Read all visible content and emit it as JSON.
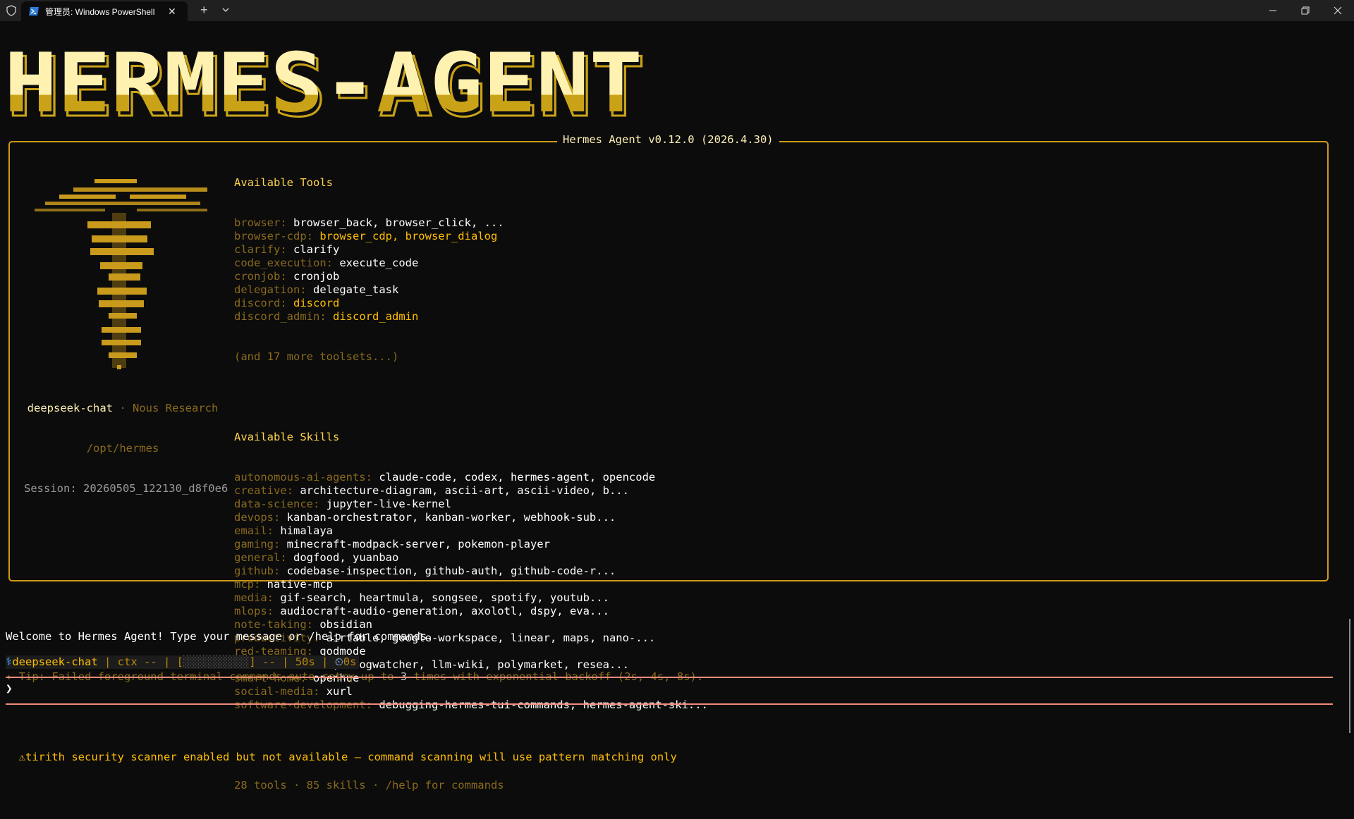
{
  "window": {
    "tab_title": "管理员: Windows PowerShell",
    "tab_icon": "powershell-icon",
    "new_tab_glyph": "+",
    "close_glyph": "✕"
  },
  "banner": {
    "logo_text": "HERMES-AGENT",
    "version_title": "Hermes Agent v0.12.0 (2026.4.30)"
  },
  "sidebar": {
    "model": "deepseek-chat",
    "separator": " · ",
    "org": "Nous Research",
    "path": "/opt/hermes",
    "session": "Session: 20260505_122130_d8f0e6"
  },
  "tools": {
    "heading": "Available Tools",
    "rows": [
      {
        "cat": "browser:",
        "items": "browser_back, browser_click, ...",
        "highlight": false
      },
      {
        "cat": "browser-cdp:",
        "items": "browser_cdp, browser_dialog",
        "highlight": true
      },
      {
        "cat": "clarify:",
        "items": "clarify",
        "highlight": false
      },
      {
        "cat": "code_execution:",
        "items": "execute_code",
        "highlight": false
      },
      {
        "cat": "cronjob:",
        "items": "cronjob",
        "highlight": false
      },
      {
        "cat": "delegation:",
        "items": "delegate_task",
        "highlight": false
      },
      {
        "cat": "discord:",
        "items": "discord",
        "highlight": true
      },
      {
        "cat": "discord_admin:",
        "items": "discord_admin",
        "highlight": true
      }
    ],
    "more": "(and 17 more toolsets...)"
  },
  "skills": {
    "heading": "Available Skills",
    "rows": [
      {
        "cat": "autonomous-ai-agents:",
        "items": "claude-code, codex, hermes-agent, opencode"
      },
      {
        "cat": "creative:",
        "items": "architecture-diagram, ascii-art, ascii-video, b..."
      },
      {
        "cat": "data-science:",
        "items": "jupyter-live-kernel"
      },
      {
        "cat": "devops:",
        "items": "kanban-orchestrator, kanban-worker, webhook-sub..."
      },
      {
        "cat": "email:",
        "items": "himalaya"
      },
      {
        "cat": "gaming:",
        "items": "minecraft-modpack-server, pokemon-player"
      },
      {
        "cat": "general:",
        "items": "dogfood, yuanbao"
      },
      {
        "cat": "github:",
        "items": "codebase-inspection, github-auth, github-code-r..."
      },
      {
        "cat": "mcp:",
        "items": "native-mcp"
      },
      {
        "cat": "media:",
        "items": "gif-search, heartmula, songsee, spotify, youtub..."
      },
      {
        "cat": "mlops:",
        "items": "audiocraft-audio-generation, axolotl, dspy, eva..."
      },
      {
        "cat": "note-taking:",
        "items": "obsidian"
      },
      {
        "cat": "productivity:",
        "items": "airtable, google-workspace, linear, maps, nano-..."
      },
      {
        "cat": "red-teaming:",
        "items": "godmode"
      },
      {
        "cat": "research:",
        "items": "arxiv, blogwatcher, llm-wiki, polymarket, resea..."
      },
      {
        "cat": "smart-home:",
        "items": "openhue"
      },
      {
        "cat": "social-media:",
        "items": "xurl"
      },
      {
        "cat": "software-development:",
        "items": "debugging-hermes-tui-commands, hermes-agent-ski..."
      }
    ],
    "summary": "28 tools · 85 skills · /help for commands"
  },
  "messages": {
    "welcome": "Welcome to Hermes Agent! Type your message or /help for commands.",
    "tip_prefix": "✦ Tip: Failed foreground terminal commands auto-retry up to ",
    "tip_num": "3",
    "tip_suffix": " times with exponential backoff (2s, 4s, 8s).",
    "warning_icon": "⚠",
    "warning": "tirith security scanner enabled but not available — command scanning will use pattern matching only"
  },
  "status": {
    "model_icon": "⚕",
    "model": "deepseek-chat",
    "sep": " | ",
    "ctx": "ctx --",
    "bar_open": "[",
    "bar_fill": "░░░░░░░░░░",
    "bar_close": "]",
    "bar_pct": "--",
    "elapsed": "50s",
    "timer_icon": "⏲",
    "timer": "0s"
  },
  "input": {
    "prompt_glyph": "❯",
    "value": ""
  },
  "colors": {
    "accent_gold": "#ffbf00",
    "border_gold": "#cd9b1a",
    "logo_cream": "#fff0b4",
    "prompt_rule": "#f08c7a"
  }
}
